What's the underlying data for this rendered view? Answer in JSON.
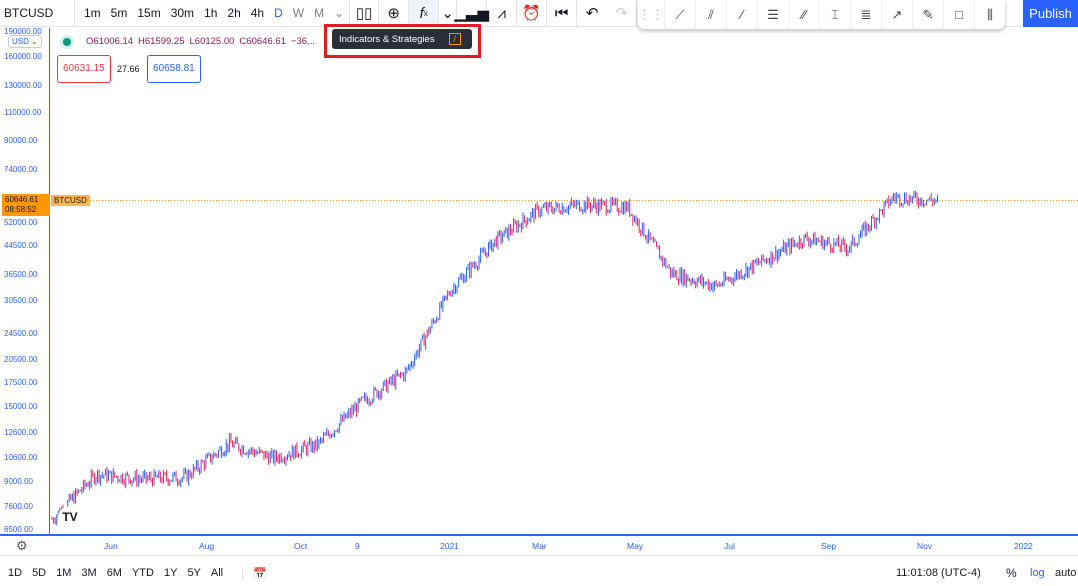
{
  "header": {
    "symbol": "BTCUSD",
    "timeframes": [
      "1m",
      "5m",
      "15m",
      "30m",
      "1h",
      "2h",
      "4h",
      "D",
      "W",
      "M"
    ],
    "active_timeframe": "D",
    "publish_label": "Publish"
  },
  "tooltip": {
    "text": "Indicators & Strategies",
    "shortcut": "/"
  },
  "legend": {
    "open": "O61006.14",
    "high": "H61599.25",
    "low": "L60125.00",
    "close": "C60646.61",
    "change": "−36..."
  },
  "trade": {
    "sell": "60631.15",
    "spread": "27.66",
    "buy": "60658.81"
  },
  "price_axis": {
    "currency": "USD",
    "labels": [
      "190000.00",
      "160000.00",
      "130000.00",
      "110000.00",
      "90000.00",
      "74000.00",
      "52000.00",
      "44500.00",
      "36500.00",
      "30500.00",
      "24500.00",
      "20500.00",
      "17500.00",
      "15000.00",
      "12600.00",
      "10600.00",
      "9000.00",
      "7600.00",
      "6500.00"
    ],
    "last_price": "60646.61",
    "countdown": "08:58:52",
    "symbol_tag": "BTCUSD"
  },
  "time_axis": {
    "labels": [
      "Jun",
      "Aug",
      "Oct",
      "9",
      "2021",
      "Mar",
      "May",
      "Jul",
      "Sep",
      "Nov",
      "2022"
    ]
  },
  "bottom": {
    "ranges": [
      "1D",
      "5D",
      "1M",
      "3M",
      "6M",
      "YTD",
      "1Y",
      "5Y",
      "All"
    ],
    "time": "11:01:08 (UTC-4)",
    "percent": "%",
    "log": "log",
    "auto": "auto"
  },
  "colors": {
    "up": "#2962ff",
    "down": "#e91e63",
    "accent": "#2962ff",
    "last_price": "#ff9800"
  },
  "chart_data": {
    "type": "candlestick",
    "scale": "log",
    "anchors_month_close": [
      [
        "2020-04",
        7000
      ],
      [
        "2020-05",
        9500
      ],
      [
        "2020-06",
        9200
      ],
      [
        "2020-07",
        9300
      ],
      [
        "2020-08",
        11700
      ],
      [
        "2020-09",
        10600
      ],
      [
        "2020-10",
        11600
      ],
      [
        "2020-11",
        15500
      ],
      [
        "2020-12",
        19000
      ],
      [
        "2021-01",
        33000
      ],
      [
        "2021-02",
        46000
      ],
      [
        "2021-03",
        57000
      ],
      [
        "2021-04",
        59000
      ],
      [
        "2021-05",
        58000
      ],
      [
        "2021-06",
        37000
      ],
      [
        "2021-07",
        34000
      ],
      [
        "2021-08",
        40000
      ],
      [
        "2021-09",
        47000
      ],
      [
        "2021-10",
        44000
      ],
      [
        "2021-11",
        62000
      ],
      [
        "2021-11-04",
        60646.61
      ]
    ]
  }
}
